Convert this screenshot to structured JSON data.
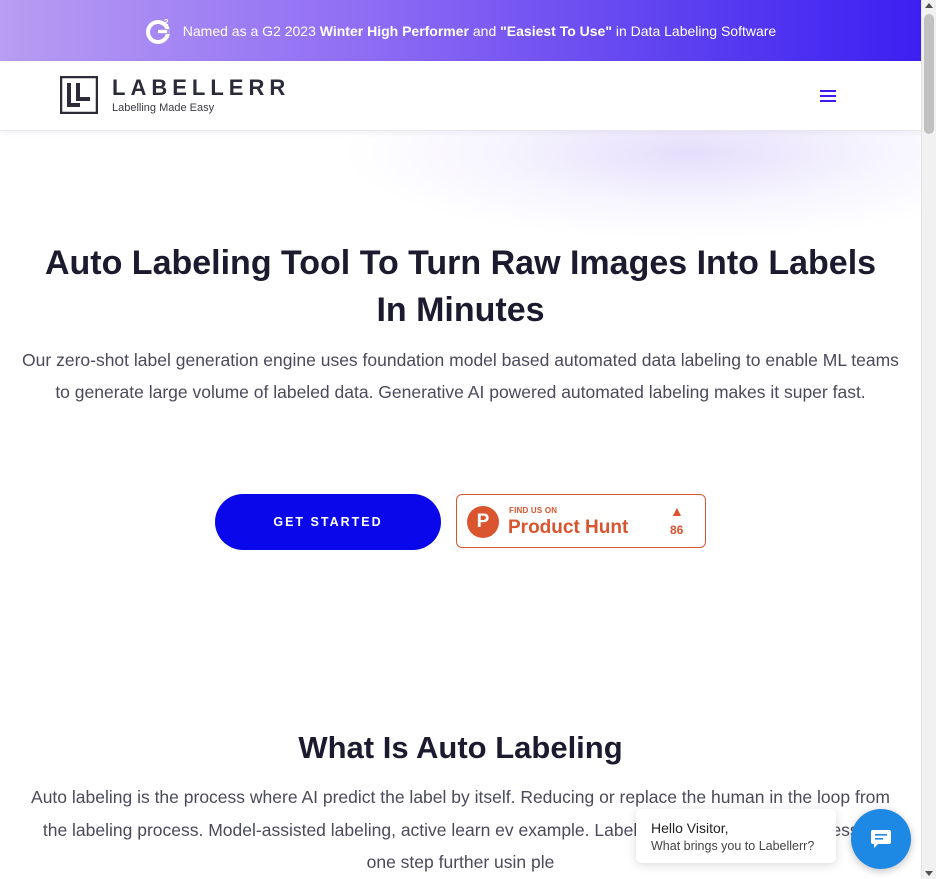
{
  "announcement": {
    "part1": "Named as a G2 2023 ",
    "bold1": "Winter High Performer",
    "part2": " and ",
    "bold2": "\"Easiest To Use\"",
    "part3": " in Data Labeling Software",
    "icon": "g2-logo-icon"
  },
  "header": {
    "logo_name": "LABELLERR",
    "logo_tagline": "Labelling Made Easy",
    "menu_icon": "hamburger-menu-icon"
  },
  "hero": {
    "title": "Auto Labeling Tool To Turn Raw Images Into Labels In Minutes",
    "description": "Our zero-shot label generation engine uses foundation model based automated data labeling to enable ML teams to generate large volume of labeled data. Generative AI powered automated  labeling makes it super fast.",
    "cta_label": "GET STARTED"
  },
  "product_hunt": {
    "find_label": "FIND US ON",
    "name": "Product Hunt",
    "logo_letter": "P",
    "arrow": "▲",
    "count": "86"
  },
  "section": {
    "title": "What Is Auto Labeling",
    "description": "Auto labeling is the process where AI predict the label by itself. Reducing or replace the human in the loop from the labeling process. Model-assisted labeling, active learn           ev example. LabelGPT have taken the process to one step further usin           ple"
  },
  "chat": {
    "hello": "Hello Visitor,",
    "message": "What brings you to Labellerr?",
    "icon": "chat-bubble-icon"
  },
  "colors": {
    "brand": "#0a08ea",
    "product_hunt": "#da552f",
    "chat": "#1e88e5"
  }
}
